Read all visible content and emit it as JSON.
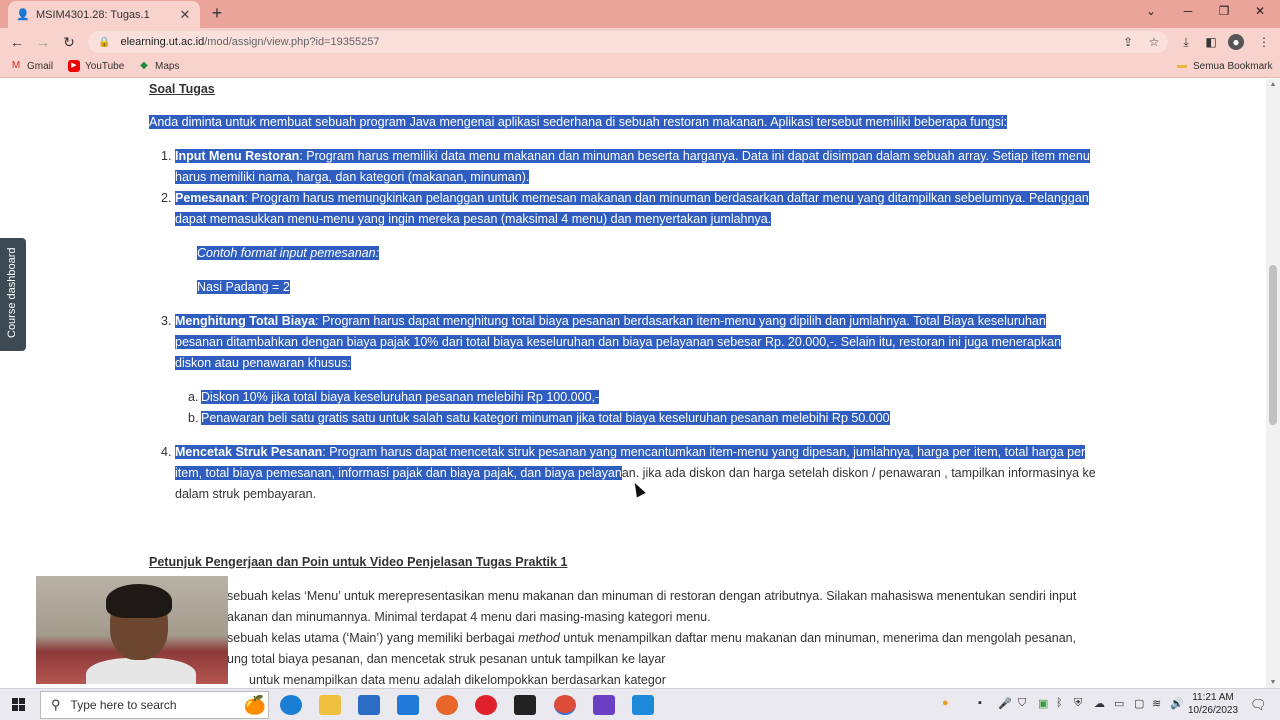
{
  "browser": {
    "tab_title": "MSIM4301.28: Tugas.1",
    "new_tab": "+",
    "url_host": "elearning.ut.ac.id",
    "url_path": "/mod/assign/view.php?id=19355257",
    "bookmarks": [
      "Gmail",
      "YouTube",
      "Maps"
    ],
    "all_bookmarks": "Semua Bookmark"
  },
  "sidebar": {
    "course_dashboard": "Course dashboard"
  },
  "content": {
    "heading_soal": "Soal Tugas",
    "intro": "Anda diminta untuk membuat sebuah program Java mengenai aplikasi sederhana di sebuah restoran makanan. Aplikasi tersebut memiliki beberapa fungsi:",
    "item1": {
      "num": "1.",
      "title": "Input Menu Restoran",
      "line1": ": Program harus memiliki data menu makanan dan minuman beserta harganya. Data ini dapat disimpan dalam sebuah array. Setiap item menu",
      "line2": "harus memiliki nama, harga, dan kategori (makanan, minuman)."
    },
    "item2": {
      "num": "2.",
      "title": "Pemesanan",
      "line1": ": Program harus memungkinkan pelanggan untuk memesan makanan dan minuman berdasarkan daftar menu yang ditampilkan sebelumnya. Pelanggan",
      "line2": "dapat memasukkan menu-menu yang ingin mereka pesan (maksimal 4 menu) dan menyertakan jumlahnya.",
      "example_label": "Contoh format input pemesanan:",
      "example_value": "Nasi Padang = 2"
    },
    "item3": {
      "num": "3.",
      "title": "Menghitung Total Biaya",
      "line1": ": Program harus dapat menghitung total biaya pesanan berdasarkan item-menu yang dipilih dan jumlahnya. Total Biaya keseluruhan",
      "line2": "pesanan ditambahkan dengan biaya pajak 10% dari total biaya keseluruhan dan biaya pelayanan sebesar Rp. 20.000,-. Selain itu, restoran ini juga menerapkan",
      "line3": "diskon atau penawaran khusus:",
      "sub_a_num": "a.",
      "sub_a": "Diskon 10% jika total biaya keseluruhan pesanan melebihi Rp 100.000,-",
      "sub_b_num": "b.",
      "sub_b": "Penawaran beli satu gratis satu untuk salah satu kategori minuman jika total biaya keseluruhan pesanan melebihi Rp 50.000"
    },
    "item4": {
      "num": "4.",
      "title": "Mencetak Struk Pesanan",
      "line1": ": Program harus dapat mencetak struk pesanan yang mencantumkan item-menu yang dipesan, jumlahnya, harga per item, total harga per",
      "line2_sel": "item, total biaya pemesanan, informasi pajak dan biaya pajak, dan biaya pelayan",
      "line2_rest": "an. jika ada diskon dan harga setelah diskon / penawaran , tampilkan informasinya ke",
      "line3": "dalam struk pembayaran."
    },
    "heading_petunjuk": "Petunjuk Pengerjaan dan Poin untuk Video Penjelasan Tugas Praktik 1",
    "p1_line1": "sebuah kelas ‘Menu’ untuk merepresentasikan menu makanan dan minuman di restoran dengan atributnya. Silakan mahasiswa menentukan sendiri input",
    "p1_line2": "akanan dan minumannya. Minimal terdapat 4 menu dari masing-masing kategori menu.",
    "p2_line1_a": "sebuah kelas utama (‘Main’) yang memiliki berbagai ",
    "p2_line1_method": "method",
    "p2_line1_b": " untuk menampilkan daftar menu makanan dan minuman, menerima dan mengolah pesanan,",
    "p2_line2": "ung total biaya pesanan, dan mencetak struk pesanan untuk tampilkan ke layar",
    "p3_line1": "untuk menampilkan data menu adalah dikelompokkan berdasarkan kategor"
  },
  "taskbar": {
    "search_placeholder": "Type here to search",
    "time": "11:21 AM",
    "date": "10/26/2023"
  }
}
